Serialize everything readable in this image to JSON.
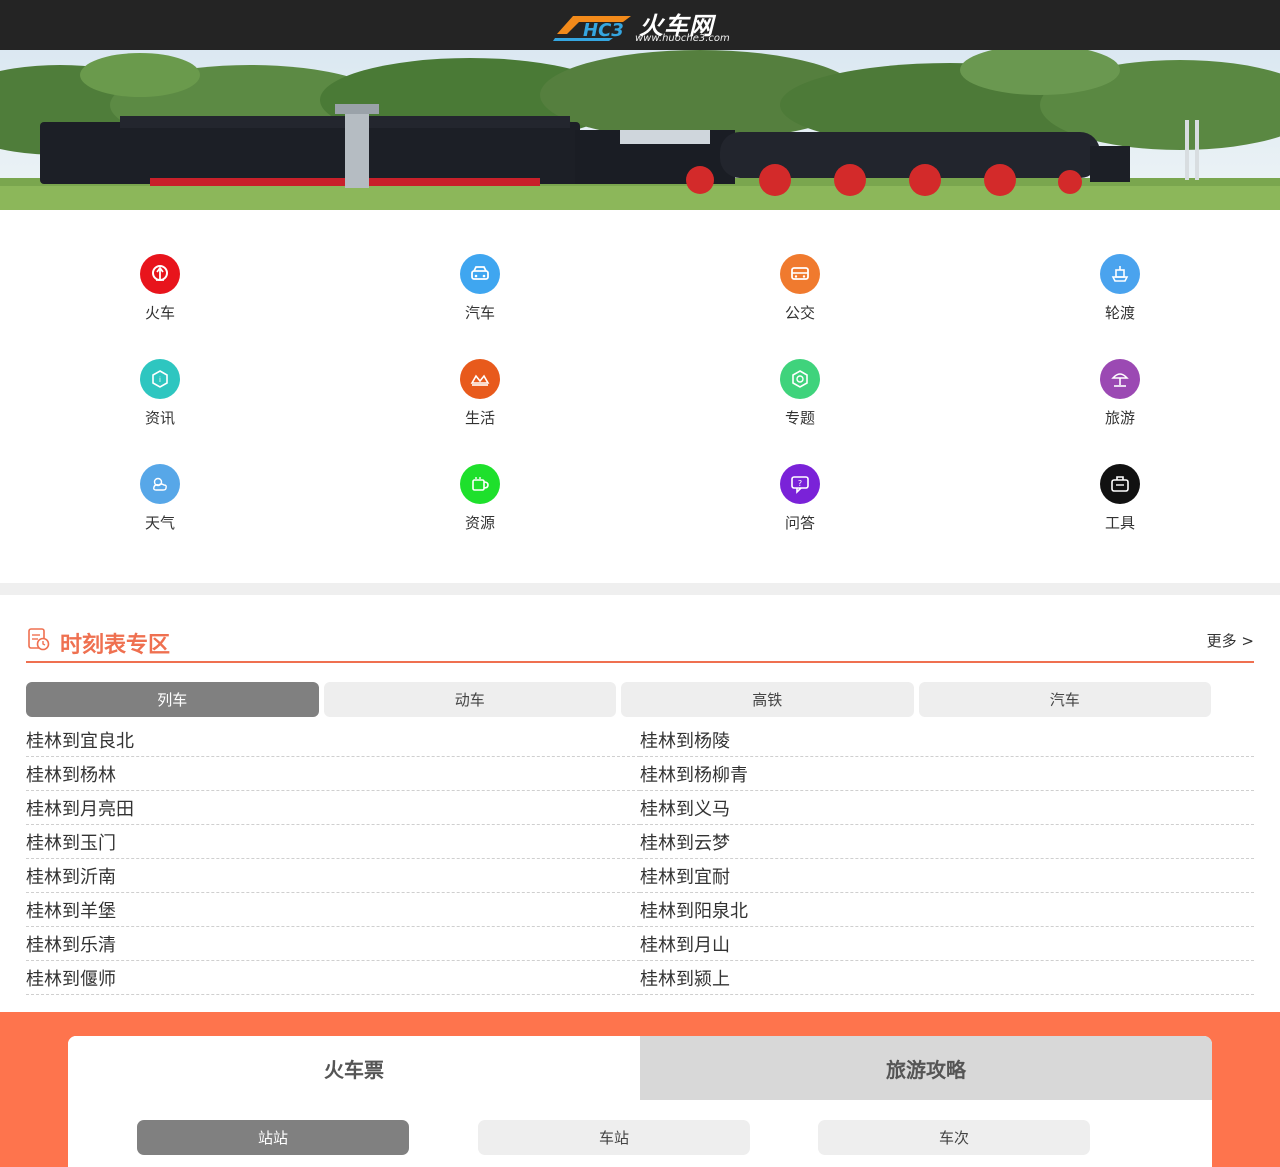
{
  "header": {
    "logo_mark": "HC3",
    "logo_name": "火车网",
    "logo_url": "www.huoche3.com"
  },
  "nav": [
    {
      "label": "火车",
      "icon": "railway-icon",
      "color": "#e8141c"
    },
    {
      "label": "汽车",
      "icon": "car-icon",
      "color": "#3fa6f0"
    },
    {
      "label": "公交",
      "icon": "bus-icon",
      "color": "#f07a2e"
    },
    {
      "label": "轮渡",
      "icon": "ship-icon",
      "color": "#4aa3ee"
    },
    {
      "label": "资讯",
      "icon": "news-icon",
      "color": "#2ec6c0"
    },
    {
      "label": "生活",
      "icon": "life-icon",
      "color": "#e85a1c"
    },
    {
      "label": "专题",
      "icon": "topic-icon",
      "color": "#3fd37c"
    },
    {
      "label": "旅游",
      "icon": "travel-icon",
      "color": "#9b49b3"
    },
    {
      "label": "天气",
      "icon": "weather-icon",
      "color": "#57a7e8"
    },
    {
      "label": "资源",
      "icon": "resource-icon",
      "color": "#1ee02c"
    },
    {
      "label": "问答",
      "icon": "qa-icon",
      "color": "#7a22d8"
    },
    {
      "label": "工具",
      "icon": "tool-icon",
      "color": "#111111"
    }
  ],
  "timetable": {
    "title": "时刻表专区",
    "more": "更多 >",
    "tabs": [
      "列车",
      "动车",
      "高铁",
      "汽车"
    ],
    "routes_left": [
      "桂林到宜良北",
      "桂林到杨林",
      "桂林到月亮田",
      "桂林到玉门",
      "桂林到沂南",
      "桂林到羊堡",
      "桂林到乐清",
      "桂林到偃师"
    ],
    "routes_right": [
      "桂林到杨陵",
      "桂林到杨柳青",
      "桂林到义马",
      "桂林到云梦",
      "桂林到宜耐",
      "桂林到阳泉北",
      "桂林到月山",
      "桂林到颍上"
    ]
  },
  "tickets": {
    "tabs": [
      "火车票",
      "旅游攻略"
    ],
    "subtabs": [
      "站站",
      "车站",
      "车次"
    ]
  },
  "colors": {
    "accent": "#ef7050",
    "bottom_bg": "#fe744d",
    "topbar": "#242424"
  }
}
